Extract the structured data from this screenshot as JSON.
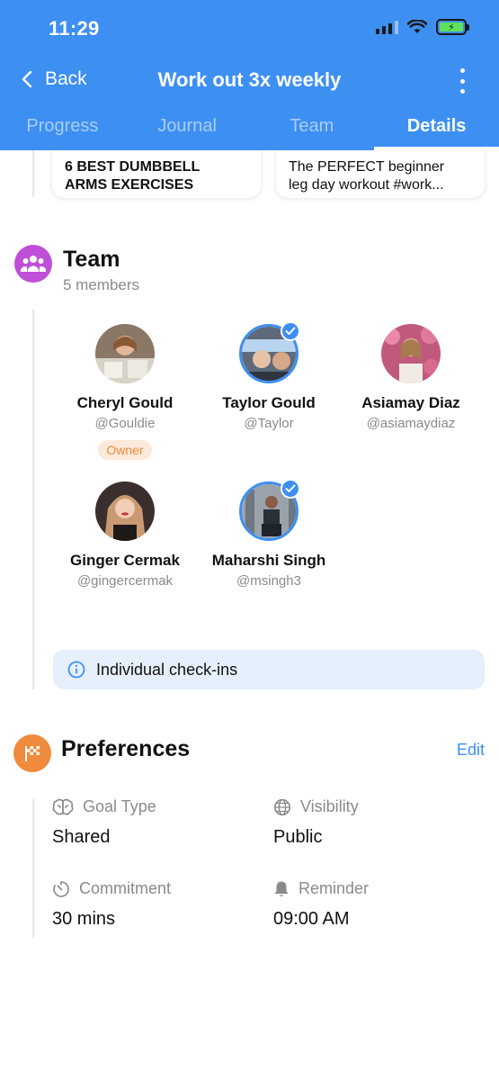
{
  "status_bar": {
    "time": "11:29"
  },
  "nav": {
    "back_label": "Back",
    "title": "Work out 3x weekly"
  },
  "tabs": [
    {
      "label": "Progress"
    },
    {
      "label": "Journal"
    },
    {
      "label": "Team"
    },
    {
      "label": "Details"
    }
  ],
  "videos": [
    {
      "title_line1": "6 BEST DUMBBELL",
      "title_line2": "ARMS EXERCISES"
    },
    {
      "title_line1": "The PERFECT beginner",
      "title_line2": "leg day workout #work..."
    }
  ],
  "team": {
    "title": "Team",
    "subtitle": "5 members",
    "members": [
      {
        "name": "Cheryl Gould",
        "handle": "@Gouldie",
        "badge": "Owner",
        "verified": false
      },
      {
        "name": "Taylor Gould",
        "handle": "@Taylor",
        "verified": true
      },
      {
        "name": "Asiamay Diaz",
        "handle": "@asiamaydiaz",
        "verified": false
      },
      {
        "name": "Ginger Cermak",
        "handle": "@gingercermak",
        "verified": false
      },
      {
        "name": "Maharshi Singh",
        "handle": "@msingh3",
        "verified": true
      }
    ],
    "checkins_label": "Individual check-ins"
  },
  "preferences": {
    "title": "Preferences",
    "edit_label": "Edit",
    "goal_type": {
      "label": "Goal Type",
      "value": "Shared"
    },
    "visibility": {
      "label": "Visibility",
      "value": "Public"
    },
    "commitment": {
      "label": "Commitment",
      "value": "30 mins"
    },
    "reminder": {
      "label": "Reminder",
      "value": "09:00 AM"
    }
  },
  "colors": {
    "header": "#3d8ff2",
    "team_icon": "#c04fd8",
    "preferences_icon": "#f08a3c",
    "owner_badge_text": "#e98a3b",
    "link": "#3d8ff2"
  }
}
